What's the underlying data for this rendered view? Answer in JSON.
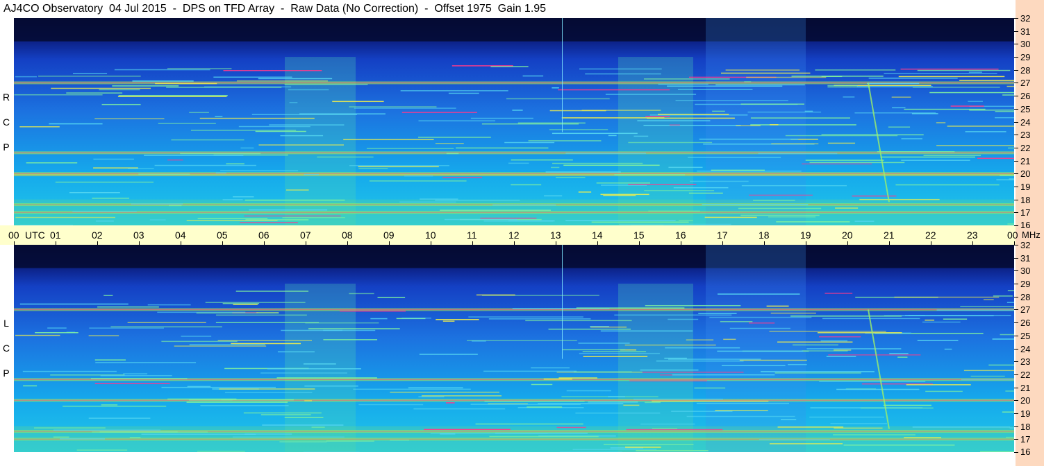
{
  "title": "AJ4CO Observatory  04 Jul 2015  -  DPS on TFD Array  -  Raw Data (No Correction)  -  Offset 1975  Gain 1.95",
  "chart_data": {
    "type": "heatmap",
    "title": "AJ4CO Observatory  04 Jul 2015  -  DPS on TFD Array  -  Raw Data (No Correction)  -  Offset 1975  Gain 1.95",
    "x_axis": {
      "unit_label": "UTC",
      "range": [
        0,
        24
      ],
      "tick_labels": [
        "00",
        "01",
        "02",
        "03",
        "04",
        "05",
        "06",
        "07",
        "08",
        "09",
        "10",
        "11",
        "12",
        "13",
        "14",
        "15",
        "16",
        "17",
        "18",
        "19",
        "20",
        "21",
        "22",
        "23",
        "00"
      ]
    },
    "y_axis": {
      "unit_label": "MHz",
      "range": [
        16,
        32
      ],
      "tick_labels": [
        "32",
        "31",
        "30",
        "29",
        "28",
        "27",
        "26",
        "25",
        "24",
        "23",
        "22",
        "21",
        "20",
        "19",
        "18",
        "17",
        "16"
      ]
    },
    "panels": [
      {
        "label": [
          "R",
          "C",
          "P"
        ],
        "name": "RCP",
        "bright_bands_mhz": [
          17.0,
          17.6,
          19.9,
          20.0,
          21.6,
          27.0
        ],
        "bright_time_blocks_utc": [
          [
            6.5,
            8.2
          ],
          [
            14.5,
            16.3
          ]
        ],
        "burst_utc": [
          20.5,
          21.0
        ]
      },
      {
        "label": [
          "L",
          "C",
          "P"
        ],
        "name": "LCP",
        "bright_bands_mhz": [
          17.0,
          17.6,
          20.0,
          21.6,
          27.0
        ],
        "bright_time_blocks_utc": [
          [
            6.5,
            8.2
          ],
          [
            14.5,
            16.3
          ]
        ],
        "burst_utc": [
          20.5,
          21.0
        ]
      }
    ]
  },
  "axis_text": {
    "utc_label": "UTC",
    "mhz_label": "MHz"
  }
}
